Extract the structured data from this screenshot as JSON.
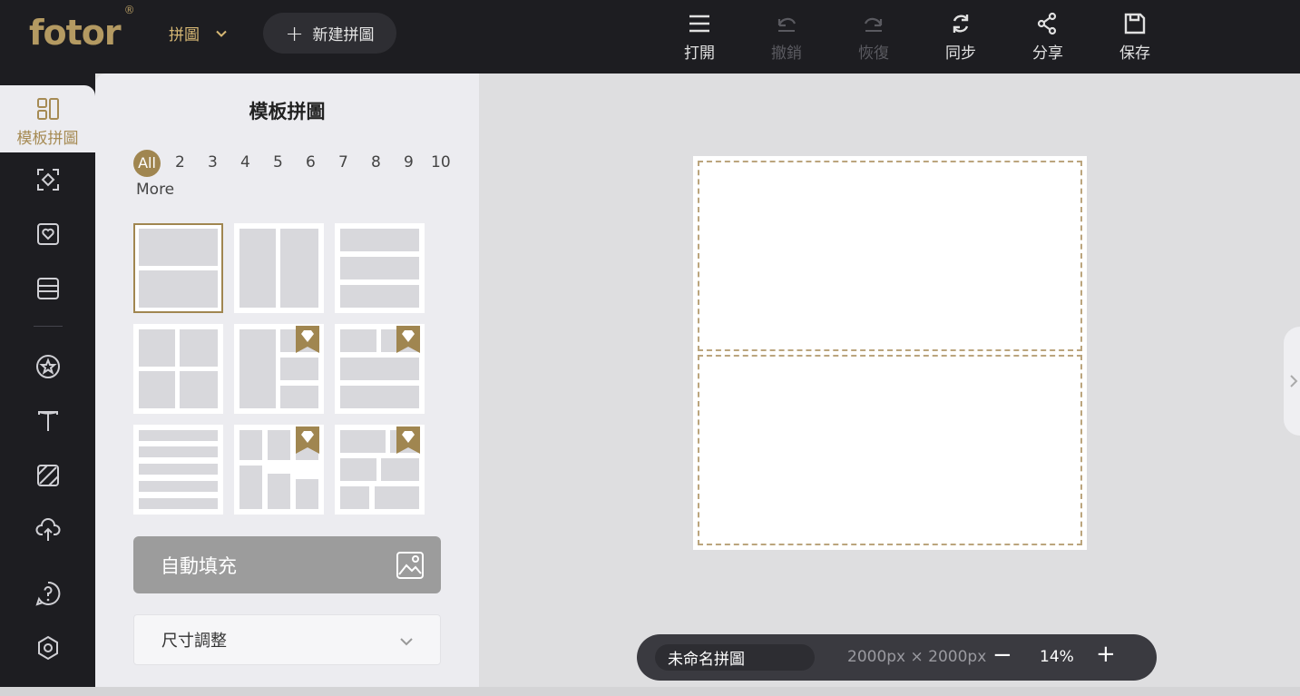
{
  "header": {
    "logo_text": "fotor",
    "logo_mark": "®",
    "mode_label": "拼圖",
    "new_button_label": "新建拼圖",
    "tools": [
      {
        "label": "打開",
        "icon": "menu-icon",
        "enabled": true
      },
      {
        "label": "撤銷",
        "icon": "undo-icon",
        "enabled": false
      },
      {
        "label": "恢復",
        "icon": "redo-icon",
        "enabled": false
      },
      {
        "label": "同步",
        "icon": "sync-icon",
        "enabled": true
      },
      {
        "label": "分享",
        "icon": "share-icon",
        "enabled": true
      },
      {
        "label": "保存",
        "icon": "save-icon",
        "enabled": true
      }
    ]
  },
  "sidebar": {
    "active_item": {
      "label": "模板拼圖",
      "icon": "template-grid-icon"
    },
    "items": [
      {
        "icon": "focus-icon"
      },
      {
        "icon": "heart-frame-icon"
      },
      {
        "icon": "layers-icon"
      },
      {
        "icon": "star-sticker-icon"
      },
      {
        "icon": "text-icon"
      },
      {
        "icon": "pattern-icon"
      },
      {
        "icon": "upload-cloud-icon"
      },
      {
        "icon": "help-icon"
      },
      {
        "icon": "settings-icon"
      }
    ]
  },
  "panel": {
    "title": "模板拼圖",
    "filters": [
      "All",
      "2",
      "3",
      "4",
      "5",
      "6",
      "7",
      "8",
      "9",
      "10",
      "More"
    ],
    "active_filter": "All",
    "auto_fill_label": "自動填充",
    "resize_label": "尺寸調整"
  },
  "footer": {
    "project_name": "未命名拼圖",
    "dimensions": "2000px × 2000px",
    "zoom_minus": "−",
    "zoom": "14%",
    "zoom_plus": "+"
  },
  "colors": {
    "accent": "#a08650",
    "topbar": "#1d1d21",
    "panel": "#ececf0"
  }
}
